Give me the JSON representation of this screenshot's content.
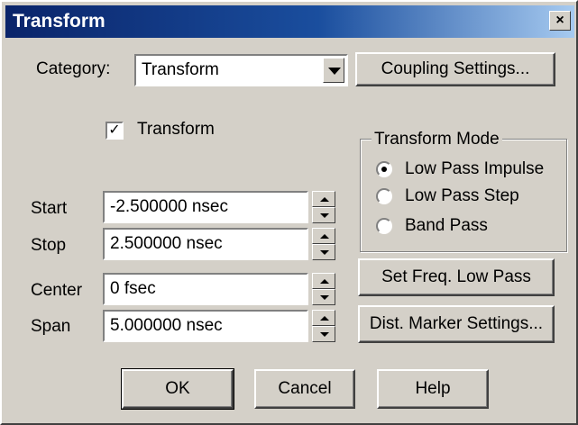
{
  "window": {
    "title": "Transform",
    "close_glyph": "×"
  },
  "category": {
    "label": "Category:",
    "value": "Transform"
  },
  "coupling_button": "Coupling Settings...",
  "transform_checkbox": {
    "label": "Transform",
    "checked": true
  },
  "transform_mode": {
    "title": "Transform Mode",
    "options": [
      {
        "label": "Low Pass Impulse",
        "selected": true
      },
      {
        "label": "Low Pass Step",
        "selected": false
      },
      {
        "label": "Band Pass",
        "selected": false
      }
    ]
  },
  "fields": [
    {
      "label": "Start",
      "value": "-2.500000 nsec"
    },
    {
      "label": "Stop",
      "value": "2.500000 nsec"
    },
    {
      "label": "Center",
      "value": "0 fsec"
    },
    {
      "label": "Span",
      "value": "5.000000 nsec"
    }
  ],
  "buttons": {
    "set_freq": "Set Freq. Low Pass",
    "dist_marker": "Dist. Marker Settings...",
    "ok": "OK",
    "cancel": "Cancel",
    "help": "Help"
  },
  "colors": {
    "title_bar": "#0a246a",
    "dialog_bg": "#d4d0c8"
  }
}
